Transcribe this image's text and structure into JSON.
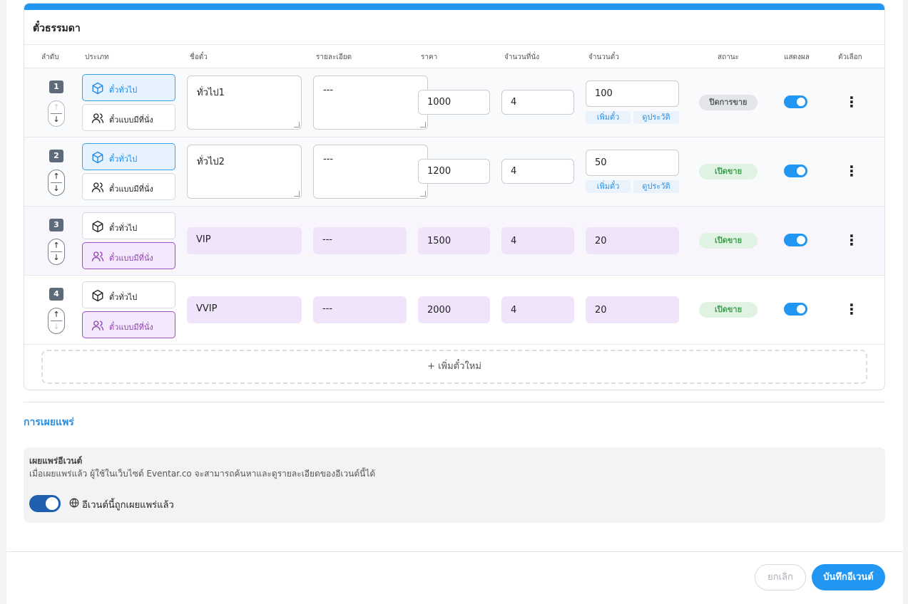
{
  "section_title": "ตั๋วธรรมดา",
  "columns": [
    "ลำดับ",
    "ประเภท",
    "ชื่อตั๋ว",
    "รายละเอียด",
    "ราคา",
    "จำนวนที่นั่ง",
    "จำนวนตั๋ว",
    "สถานะ",
    "แสดงผล",
    "ตัวเลือก"
  ],
  "type_labels": {
    "general": "ตั๋วทั่วไป",
    "seated": "ตั๋วแบบมีที่นั่ง"
  },
  "tiny_buttons": {
    "add": "เพิ่มตั๋ว",
    "history": "ดูประวัติ"
  },
  "rows": [
    {
      "index": "1",
      "type": "general",
      "name": "ทั่วไป1",
      "detail": "---",
      "price": "1000",
      "seats": "4",
      "tickets": "100",
      "status": "ปิดการขาย",
      "status_kind": "closed",
      "visible": true
    },
    {
      "index": "2",
      "type": "general",
      "name": "ทั่วไป2",
      "detail": "---",
      "price": "1200",
      "seats": "4",
      "tickets": "50",
      "status": "เปิดขาย",
      "status_kind": "open",
      "visible": true
    },
    {
      "index": "3",
      "type": "seated",
      "name": "VIP",
      "detail": "---",
      "price": "1500",
      "seats": "4",
      "tickets": "20",
      "status": "เปิดขาย",
      "status_kind": "open",
      "visible": true
    },
    {
      "index": "4",
      "type": "seated",
      "name": "VVIP",
      "detail": "---",
      "price": "2000",
      "seats": "4",
      "tickets": "20",
      "status": "เปิดขาย",
      "status_kind": "open",
      "visible": true
    }
  ],
  "add_ticket_label": "+ เพิ่มตั๋วใหม่",
  "publish": {
    "section_title": "การเผยแพร่",
    "heading": "เผยแพร่อีเวนต์",
    "description": "เมื่อเผยแพร่แล้ว ผู้ใช้ในเว็บไซต์ Eventar.co จะสามารถค้นหาและดูรายละเอียดของอีเวนต์นี้ได้",
    "state_label": "อีเวนต์นี้ถูกเผยแพร่แล้ว",
    "enabled": true
  },
  "footer": {
    "cancel": "ยกเลิก",
    "save": "บันทึกอีเวนต์"
  },
  "colors": {
    "accent": "#2196f3",
    "purple": "#9b4dca",
    "open": "#3f9f4f"
  }
}
